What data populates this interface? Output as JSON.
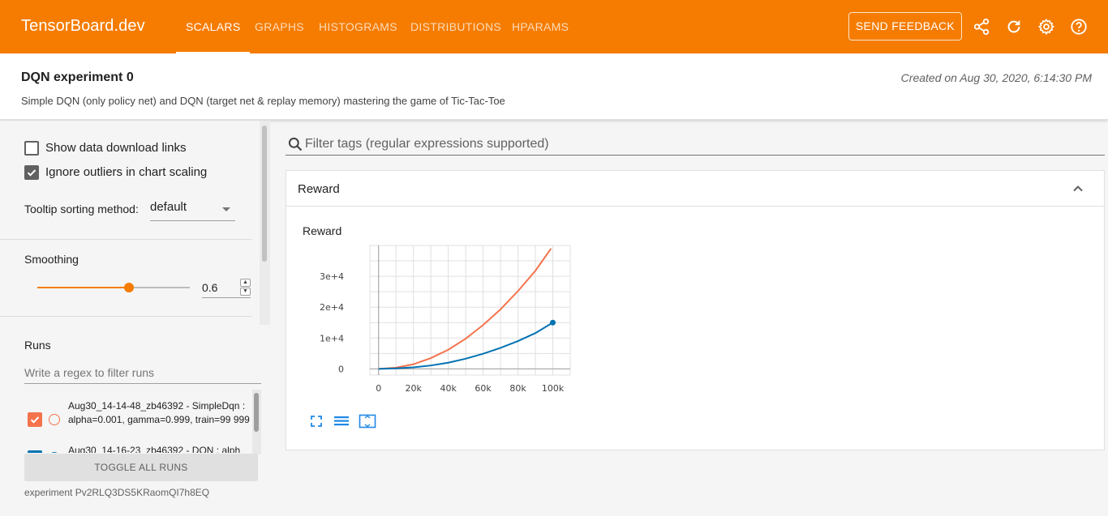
{
  "app": {
    "brand": "TensorBoard.dev",
    "tabs": [
      "SCALARS",
      "GRAPHS",
      "HISTOGRAMS",
      "DISTRIBUTIONS",
      "HPARAMS"
    ],
    "active_tab": "SCALARS",
    "feedback_label": "SEND FEEDBACK",
    "accent_color": "#f57c00"
  },
  "header": {
    "title": "DQN experiment 0",
    "description": "Simple DQN (only policy net) and DQN (target net & replay memory) mastering the game of Tic-Tac-Toe",
    "created": "Created on Aug 30, 2020, 6:14:30 PM"
  },
  "sidebar": {
    "show_download_links": {
      "label": "Show data download links",
      "checked": false
    },
    "ignore_outliers": {
      "label": "Ignore outliers in chart scaling",
      "checked": true
    },
    "tooltip_label": "Tooltip sorting method:",
    "tooltip_value": "default",
    "smoothing_label": "Smoothing",
    "smoothing_value": "0.6",
    "smoothing_fraction": 0.6,
    "runs_title": "Runs",
    "runs_filter_placeholder": "Write a regex to filter runs",
    "runs": [
      {
        "name": "Aug30_14-14-48_zb46392 - SimpleDqn : alpha=0.001, gamma=0.999, train=99 999",
        "color": "#f4734d",
        "checked": true
      },
      {
        "name": "Aug30_14-16-23_zb46392 - DQN : alph",
        "color": "#0072b2",
        "checked": true
      }
    ],
    "toggle_all_label": "TOGGLE ALL RUNS",
    "experiment_id": "experiment Pv2RLQ3DS5KRaomQI7h8EQ"
  },
  "main": {
    "filter_placeholder": "Filter tags (regular expressions supported)",
    "card_title": "Reward",
    "chart_title": "Reward"
  },
  "chart_data": {
    "type": "line",
    "title": "Reward",
    "xlabel": "",
    "ylabel": "",
    "x_ticks": [
      "0",
      "20k",
      "40k",
      "60k",
      "80k",
      "100k"
    ],
    "y_ticks": [
      "0",
      "1e+4",
      "2e+4",
      "3e+4"
    ],
    "xlim": [
      -5000,
      110000
    ],
    "ylim": [
      -2000,
      40000
    ],
    "grid": true,
    "series": [
      {
        "color": "#f4734d",
        "x": [
          0,
          10000,
          20000,
          30000,
          40000,
          50000,
          60000,
          70000,
          80000,
          90000,
          99000
        ],
        "y": [
          0,
          400,
          1500,
          3500,
          6200,
          9800,
          14200,
          19300,
          25200,
          31800,
          39000
        ]
      },
      {
        "color": "#0072b2",
        "x": [
          0,
          10000,
          20000,
          30000,
          40000,
          50000,
          60000,
          70000,
          80000,
          90000,
          99999
        ],
        "y": [
          0,
          150,
          500,
          1100,
          2000,
          3300,
          4900,
          6800,
          9000,
          11600,
          15000
        ]
      }
    ]
  }
}
